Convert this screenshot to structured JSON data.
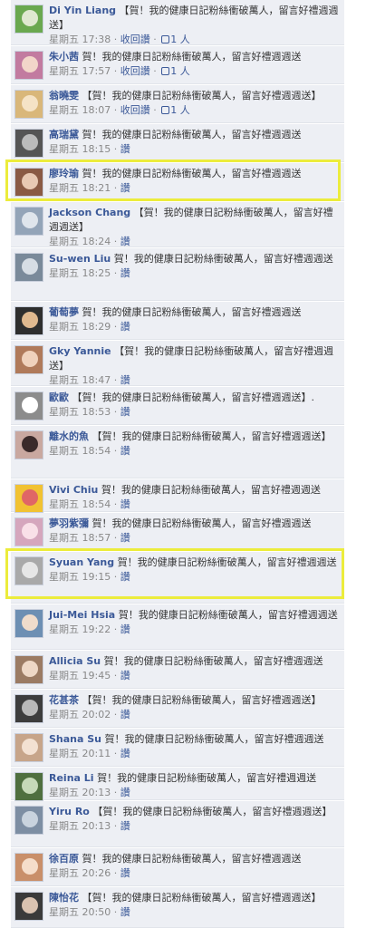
{
  "comments": [
    {
      "name": "Di Yin Liang",
      "text": "【賀！我的健康日記粉絲衝破萬人，留言好禮週週送】",
      "time": "星期五 17:38",
      "unlike": "收回讚",
      "likes": "1 人",
      "av": "#6aa84f"
    },
    {
      "name": "朱小茜",
      "text": "賀！我的健康日記粉絲衝破萬人，留言好禮週週送",
      "time": "星期五 17:57",
      "unlike": "收回讚",
      "likes": "1 人",
      "av": "#c27ba0"
    },
    {
      "name": "翁曉雯",
      "text": "【賀！我的健康日記粉絲衝破萬人，留言好禮週週送】",
      "time": "星期五 18:07",
      "unlike": "收回讚",
      "likes": "1 人",
      "av": "#d9b77a"
    },
    {
      "name": "高瑞黛",
      "text": "賀！我的健康日記粉絲衝破萬人，留言好禮週週送",
      "time": "星期五 18:15",
      "like": "讚",
      "av": "#555555"
    },
    {
      "name": "廖玲瑜",
      "text": "賀！我的健康日記粉絲衝破萬人，留言好禮週週送",
      "time": "星期五 18:21",
      "like": "讚",
      "av": "#8a5a44"
    },
    {
      "name": "Jackson Chang",
      "text": "【賀！我的健康日記粉絲衝破萬人，留言好禮週週送】",
      "time": "星期五 18:24",
      "like": "讚",
      "av": "#93a4b8"
    },
    {
      "name": "Su-wen Liu",
      "text": "賀！我的健康日記粉絲衝破萬人，留言好禮週週送",
      "time": "星期五 18:25",
      "like": "讚",
      "av": "#7a8a9a"
    },
    {
      "name": "葡萄夢",
      "text": "賀！我的健康日記粉絲衝破萬人，留言好禮週週送",
      "time": "星期五 18:29",
      "like": "讚",
      "av": "#2e2e2e"
    },
    {
      "name": "Gky Yannie",
      "text": "【賀！我的健康日記粉絲衝破萬人，留言好禮週週送】",
      "time": "星期五 18:47",
      "like": "讚",
      "av": "#b07a5a"
    },
    {
      "name": "歐歐",
      "text": "【賀！我的健康日記粉絲衝破萬人，留言好禮週週送】.",
      "time": "星期五 18:53",
      "like": "讚",
      "av": "#8c8c8c"
    },
    {
      "name": "離水的魚",
      "text": "【賀！我的健康日記粉絲衝破萬人，留言好禮週週送】",
      "time": "星期五 18:54",
      "like": "讚",
      "av": "#c9a8a0"
    },
    {
      "name": "Vivi Chiu",
      "text": "賀！我的健康日記粉絲衝破萬人，留言好禮週週送",
      "time": "星期五 18:54",
      "like": "讚",
      "av": "#f1c232"
    },
    {
      "name": "夢羽紫彌",
      "text": "賀！我的健康日記粉絲衝破萬人，留言好禮週週送",
      "time": "星期五 18:57",
      "like": "讚",
      "av": "#d5a6bd"
    },
    {
      "name": "Syuan Yang",
      "text": "賀！我的健康日記粉絲衝破萬人，留言好禮週週送",
      "time": "星期五 19:15",
      "like": "讚",
      "av": "#a9a9a9"
    },
    {
      "name": "Jui-Mei Hsia",
      "text": "賀！我的健康日記粉絲衝破萬人，留言好禮週週送",
      "time": "星期五 19:22",
      "like": "讚",
      "av": "#6d8fb3"
    },
    {
      "name": "Allicia Su",
      "text": "賀！我的健康日記粉絲衝破萬人，留言好禮週週送",
      "time": "星期五 19:45",
      "like": "讚",
      "av": "#9b7b63"
    },
    {
      "name": "花甚茶",
      "text": "【賀！我的健康日記粉絲衝破萬人，留言好禮週週送】",
      "time": "星期五 20:02",
      "like": "讚",
      "av": "#3d3d3d"
    },
    {
      "name": "Shana Su",
      "text": "賀！我的健康日記粉絲衝破萬人，留言好禮週週送",
      "time": "星期五 20:11",
      "like": "讚",
      "av": "#c7a58a"
    },
    {
      "name": "Reina Li",
      "text": "賀！我的健康日記粉絲衝破萬人，留言好禮週週送",
      "time": "星期五 20:13",
      "like": "讚",
      "av": "#4f6f3f"
    },
    {
      "name": "Yiru Ro",
      "text": "【賀！我的健康日記粉絲衝破萬人，留言好禮週週送】",
      "time": "星期五 20:13",
      "like": "讚",
      "av": "#7d8ea3"
    },
    {
      "name": "徐百原",
      "text": "賀！我的健康日記粉絲衝破萬人，留言好禮週週送",
      "time": "星期五 20:26",
      "like": "讚",
      "av": "#c98f6a"
    },
    {
      "name": "陳怡花",
      "text": "【賀！我的健康日記粉絲衝破萬人，留言好禮週週送】",
      "time": "星期五 20:50",
      "like": "讚",
      "av": "#3a3a3a"
    }
  ],
  "colors": {
    "link": "#3b5998",
    "panel": "#edeff4",
    "highlight": "#ecec3c"
  }
}
